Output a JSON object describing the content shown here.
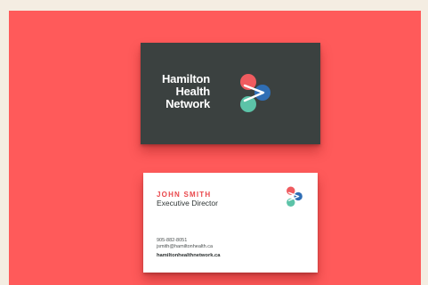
{
  "front_card": {
    "brand_lines": [
      "Hamilton",
      "Health",
      "Network"
    ]
  },
  "back_card": {
    "name": "JOHN SMITH",
    "title": "Executive Director",
    "phone": "905-882-8051",
    "email": "jsmith@hamiltonhealth.ca",
    "website": "hamiltonhealthnetwork.ca"
  },
  "colors": {
    "background": "#ff5a5a",
    "page_border": "#f4ede2",
    "dark_card": "#3b4140",
    "logo_red": "#ef5b5f",
    "logo_blue": "#2f6eb5",
    "logo_teal": "#5cc3a8"
  },
  "icons": {
    "logo": "hamilton-health-logo-icon"
  }
}
